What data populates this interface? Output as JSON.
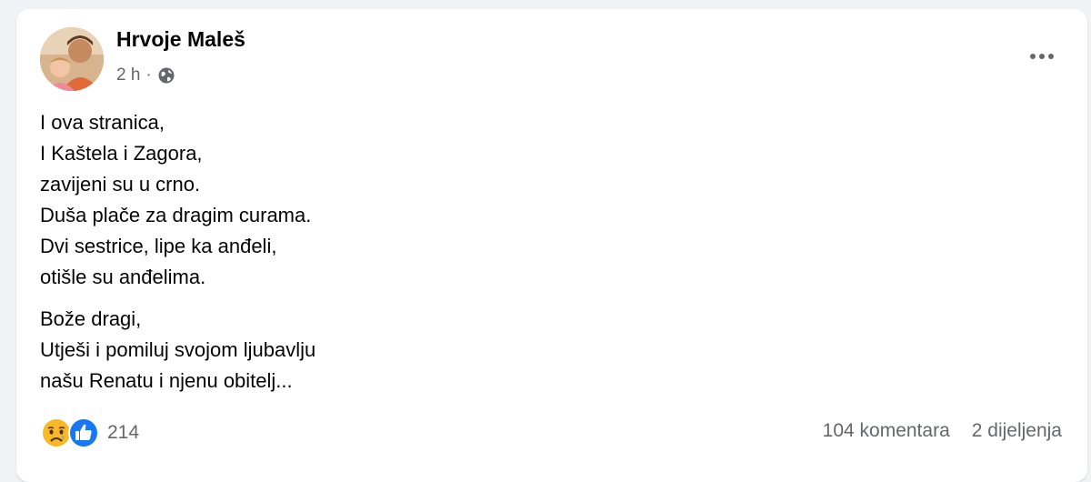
{
  "post": {
    "author": "Hrvoje Maleš",
    "time": "2 h",
    "separator": "·",
    "audience_icon": "globe-icon",
    "more_icon": "more-options-icon",
    "paragraphs": [
      {
        "lines": [
          "I ova stranica,",
          "I Kaštela i Zagora,",
          "zavijeni su u crno.",
          "Duša plače za dragim curama.",
          "Dvi sestrice, lipe ka anđeli,",
          "otišle su anđelima."
        ]
      },
      {
        "lines": [
          "Bože dragi,",
          "Utješi i pomiluj svojom ljubavlju",
          "našu Renatu i njenu obitelj..."
        ]
      }
    ],
    "reactions": {
      "icons": [
        "sad-reaction-icon",
        "like-reaction-icon"
      ],
      "count": "214"
    },
    "comments": "104 komentara",
    "shares": "2 dijeljenja"
  },
  "colors": {
    "page_background": "#f0f2f5",
    "card_background": "#ffffff",
    "primary_text": "#050505",
    "secondary_text": "#65676b",
    "like_blue": "#1877f2",
    "sad_yellow": "#f7b928"
  }
}
